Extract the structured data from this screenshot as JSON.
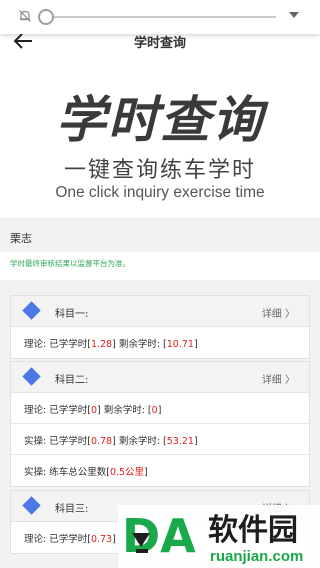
{
  "volume_panel": {
    "bell_icon": "bell-off-icon",
    "chevron_icon": "chevron-down-icon"
  },
  "header": {
    "title": "学时查询",
    "back_icon": "back-arrow-icon"
  },
  "banner": {
    "title": "学时查询",
    "subtitle": "一键查询练车学时",
    "english": "One click inquiry exercise time"
  },
  "student": {
    "name": "栗志"
  },
  "notice": "学时最终审核结果以监督平台为准。",
  "subjects": [
    {
      "name": "科目一:",
      "detail": "详细 〉",
      "rows": [
        {
          "prefix": "理论: 已学学时[",
          "learned": "1.28",
          "mid": "] 剩余学时: [",
          "remaining": "10.71",
          "suffix": "]"
        }
      ]
    },
    {
      "name": "科目二:",
      "detail": "详细 〉",
      "rows": [
        {
          "prefix": "理论: 已学学时[",
          "learned": "0",
          "mid": "] 剩余学时: [",
          "remaining": "0",
          "suffix": "]"
        },
        {
          "prefix": "实操: 已学学时[",
          "learned": "0.78",
          "mid": "] 剩余学时: [",
          "remaining": "53.21",
          "suffix": "]"
        },
        {
          "prefix": "实操: 练车总公里数[",
          "km": "0.5公里",
          "suffix": "]"
        }
      ]
    },
    {
      "name": "科目三:",
      "detail": "详细 〉",
      "rows": [
        {
          "prefix": "理论: 已学学时[",
          "learned": "0.73",
          "suffix": "]"
        }
      ]
    }
  ],
  "watermark": {
    "logo_text": "DA",
    "cn": "软件园",
    "url": "ruanjian.com"
  },
  "colors": {
    "accent_blue": "#4b78e6",
    "value_red": "#e02020",
    "notice_green": "#2eaa55",
    "watermark_green": "#19a84a"
  }
}
